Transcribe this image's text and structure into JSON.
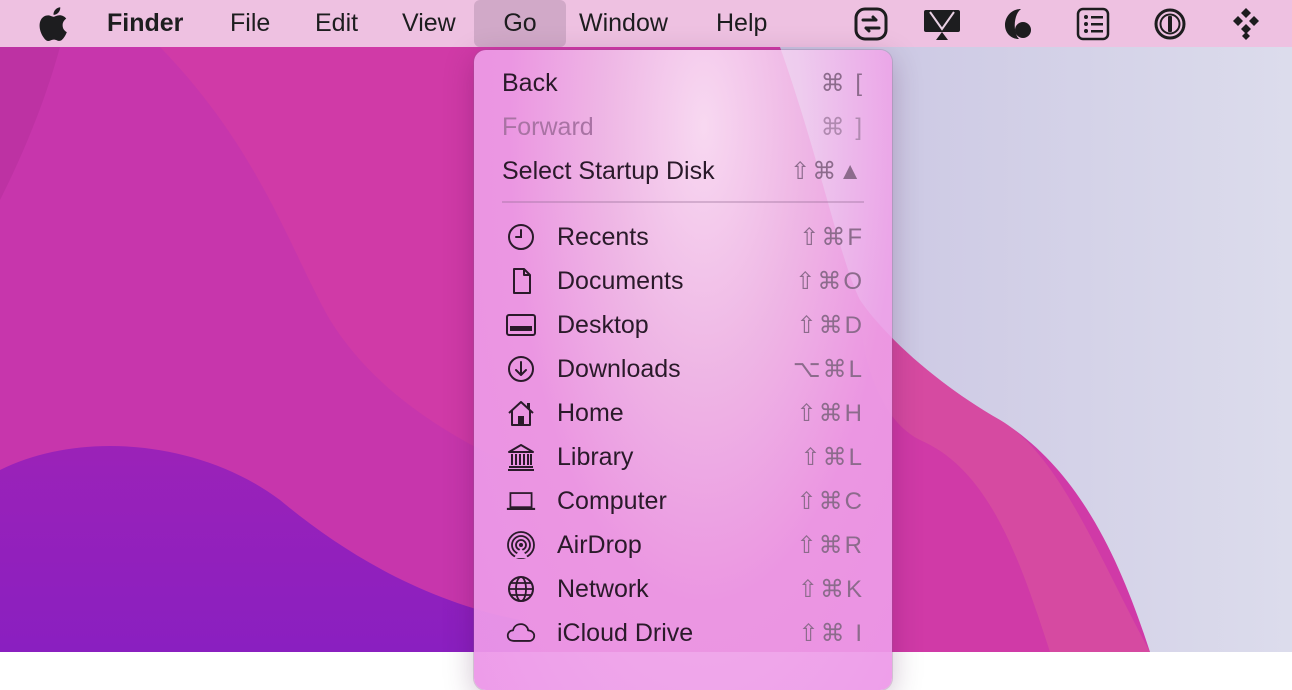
{
  "menubar": {
    "app_name": "Finder",
    "menus": [
      "File",
      "Edit",
      "View",
      "Go",
      "Window",
      "Help"
    ]
  },
  "status_icons": [
    "control-center-icon",
    "airplay-display-icon",
    "night-shift-icon",
    "reminders-list-icon",
    "1password-icon",
    "diamond-grid-icon"
  ],
  "go_menu": {
    "top_items": [
      {
        "label": "Back",
        "shortcut": "⌘ [",
        "disabled": false
      },
      {
        "label": "Forward",
        "shortcut": "⌘ ]",
        "disabled": true
      },
      {
        "label": "Select Startup Disk",
        "shortcut": "⇧⌘▲",
        "disabled": false
      }
    ],
    "places": [
      {
        "label": "Recents",
        "shortcut": "⇧⌘F",
        "icon": "clock-icon"
      },
      {
        "label": "Documents",
        "shortcut": "⇧⌘O",
        "icon": "document-icon"
      },
      {
        "label": "Desktop",
        "shortcut": "⇧⌘D",
        "icon": "desktop-icon"
      },
      {
        "label": "Downloads",
        "shortcut": "⌥⌘L",
        "icon": "download-icon"
      },
      {
        "label": "Home",
        "shortcut": "⇧⌘H",
        "icon": "home-icon"
      },
      {
        "label": "Library",
        "shortcut": "⇧⌘L",
        "icon": "library-icon"
      },
      {
        "label": "Computer",
        "shortcut": "⇧⌘C",
        "icon": "laptop-icon"
      },
      {
        "label": "AirDrop",
        "shortcut": "⇧⌘R",
        "icon": "airdrop-icon"
      },
      {
        "label": "Network",
        "shortcut": "⇧⌘K",
        "icon": "globe-icon"
      },
      {
        "label": "iCloud Drive",
        "shortcut": "⇧⌘ I",
        "icon": "cloud-icon"
      }
    ]
  }
}
